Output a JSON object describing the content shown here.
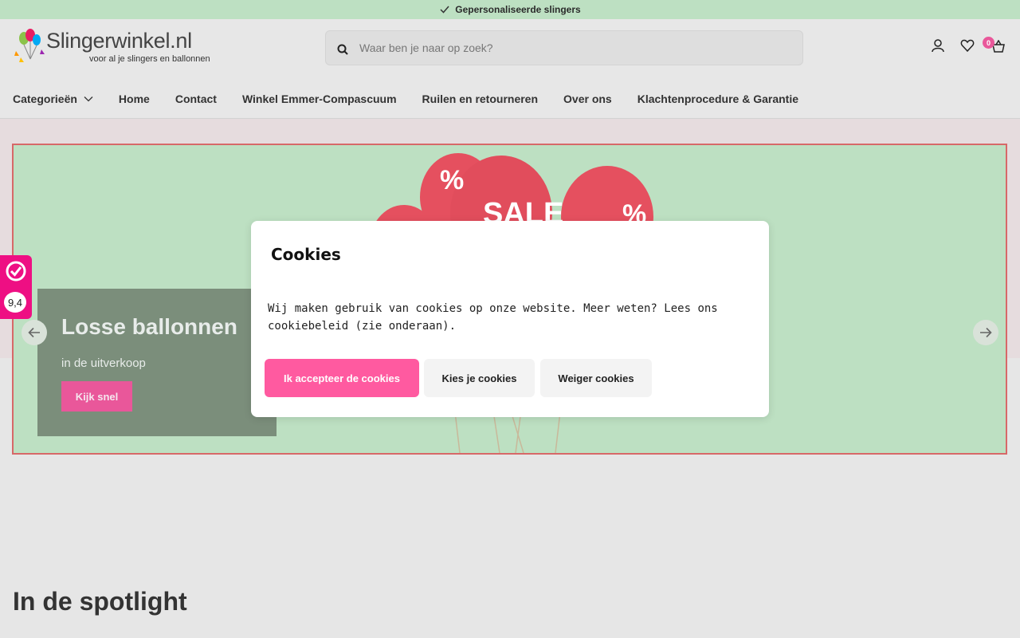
{
  "topbar": {
    "message": "Gepersonaliseerde slingers",
    "icon": "check-icon"
  },
  "header": {
    "logo": {
      "name": "Slingerwinkel.nl",
      "tagline": "voor al je slingers en ballonnen"
    },
    "search": {
      "placeholder": "Waar ben je naar op zoek?",
      "value": ""
    },
    "cart_count": "0",
    "icons": [
      "user-icon",
      "heart-icon",
      "cart-icon"
    ]
  },
  "nav": {
    "items": [
      {
        "label": "Categorieën",
        "has_dropdown": true
      },
      {
        "label": "Home"
      },
      {
        "label": "Contact"
      },
      {
        "label": "Winkel Emmer-Compascuum"
      },
      {
        "label": "Ruilen en retourneren"
      },
      {
        "label": "Over ons"
      },
      {
        "label": "Klachtenprocedure & Garantie"
      }
    ]
  },
  "hero": {
    "title": "Losse ballonnen",
    "subtitle": "in de uitverkoop",
    "button": "Kijk snel",
    "balloon_texts": [
      "SALE",
      "%",
      "%"
    ]
  },
  "rating": {
    "score": "9,4"
  },
  "cookie_dialog": {
    "title": "Cookies",
    "text": "Wij maken gebruik van cookies op onze website. Meer weten? Lees ons cookiebeleid (zie onderaan).",
    "accept": "Ik accepteer de cookies",
    "choose": "Kies je cookies",
    "refuse": "Weiger cookies"
  },
  "sections": {
    "spotlight_title": "In de spotlight"
  },
  "colors": {
    "accent": "#ff5aa0",
    "brand_pink": "#e9579a",
    "green_bar": "#bde0c2",
    "rating_pink": "#ee0f83"
  }
}
